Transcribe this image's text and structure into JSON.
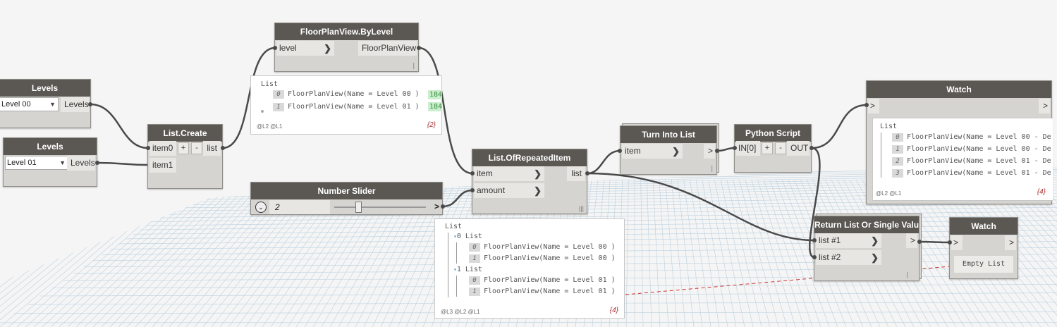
{
  "nodes": {
    "levels_a": {
      "title": "Levels",
      "selected": "Level 00",
      "output": "Levels"
    },
    "levels_b": {
      "title": "Levels",
      "selected": "Level 01",
      "output": "Levels"
    },
    "list_create": {
      "title": "List.Create",
      "inputs": [
        "item0",
        "item1"
      ],
      "add": "+",
      "remove": "-",
      "output": "list"
    },
    "floorplan": {
      "title": "FloorPlanView.ByLevel",
      "input": "level",
      "output": "FloorPlanView"
    },
    "number_slider": {
      "title": "Number Slider",
      "value": "2",
      "slider_fraction": 0.23
    },
    "repeated": {
      "title": "List.OfRepeatedItem",
      "inputs": [
        "item",
        "amount"
      ],
      "output": "list",
      "lacing": "|||"
    },
    "turn_into_list": {
      "title": "Turn Into List",
      "input": "item"
    },
    "python": {
      "title": "Python Script",
      "input": "IN[0]",
      "add": "+",
      "remove": "-",
      "output": "OUT"
    },
    "watch_main": {
      "title": "Watch"
    },
    "return_list": {
      "title": "Return List Or Single Value",
      "inputs": [
        "list #1",
        "list #2"
      ]
    },
    "watch_small": {
      "title": "Watch",
      "empty_text": "Empty List"
    }
  },
  "previews": {
    "floorplan": {
      "header": "List",
      "items": [
        {
          "index": "0",
          "text": "FloorPlanView(Name = Level 00 )",
          "tag": "184"
        },
        {
          "index": "1",
          "text": "FloorPlanView(Name = Level 01 )",
          "tag": "184"
        }
      ],
      "levels": "@L2 @L1",
      "count": "{2}"
    },
    "repeated": {
      "header": "List",
      "groups": [
        {
          "label": "0 List",
          "items": [
            {
              "index": "0",
              "text": "FloorPlanView(Name = Level 00 )"
            },
            {
              "index": "1",
              "text": "FloorPlanView(Name = Level 00 )"
            }
          ]
        },
        {
          "label": "1 List",
          "items": [
            {
              "index": "0",
              "text": "FloorPlanView(Name = Level 01 )"
            },
            {
              "index": "1",
              "text": "FloorPlanView(Name = Level 01 )"
            }
          ]
        }
      ],
      "levels": "@L3 @L2 @L1",
      "count": "{4}"
    },
    "watch": {
      "header": "List",
      "items": [
        {
          "index": "0",
          "text": "FloorPlanView(Name = Level 00 - De"
        },
        {
          "index": "1",
          "text": "FloorPlanView(Name = Level 00 - De"
        },
        {
          "index": "2",
          "text": "FloorPlanView(Name = Level 01 - De"
        },
        {
          "index": "3",
          "text": "FloorPlanView(Name = Level 01 - De"
        }
      ],
      "levels": "@L2 @L1",
      "count": "{4}"
    }
  },
  "colors": {
    "node_header": "#5b5854",
    "node_body": "#d6d4d0",
    "wire": "#4a4a4a",
    "grid": "#a8c4d8",
    "preview_tag": "#c9efcc"
  }
}
